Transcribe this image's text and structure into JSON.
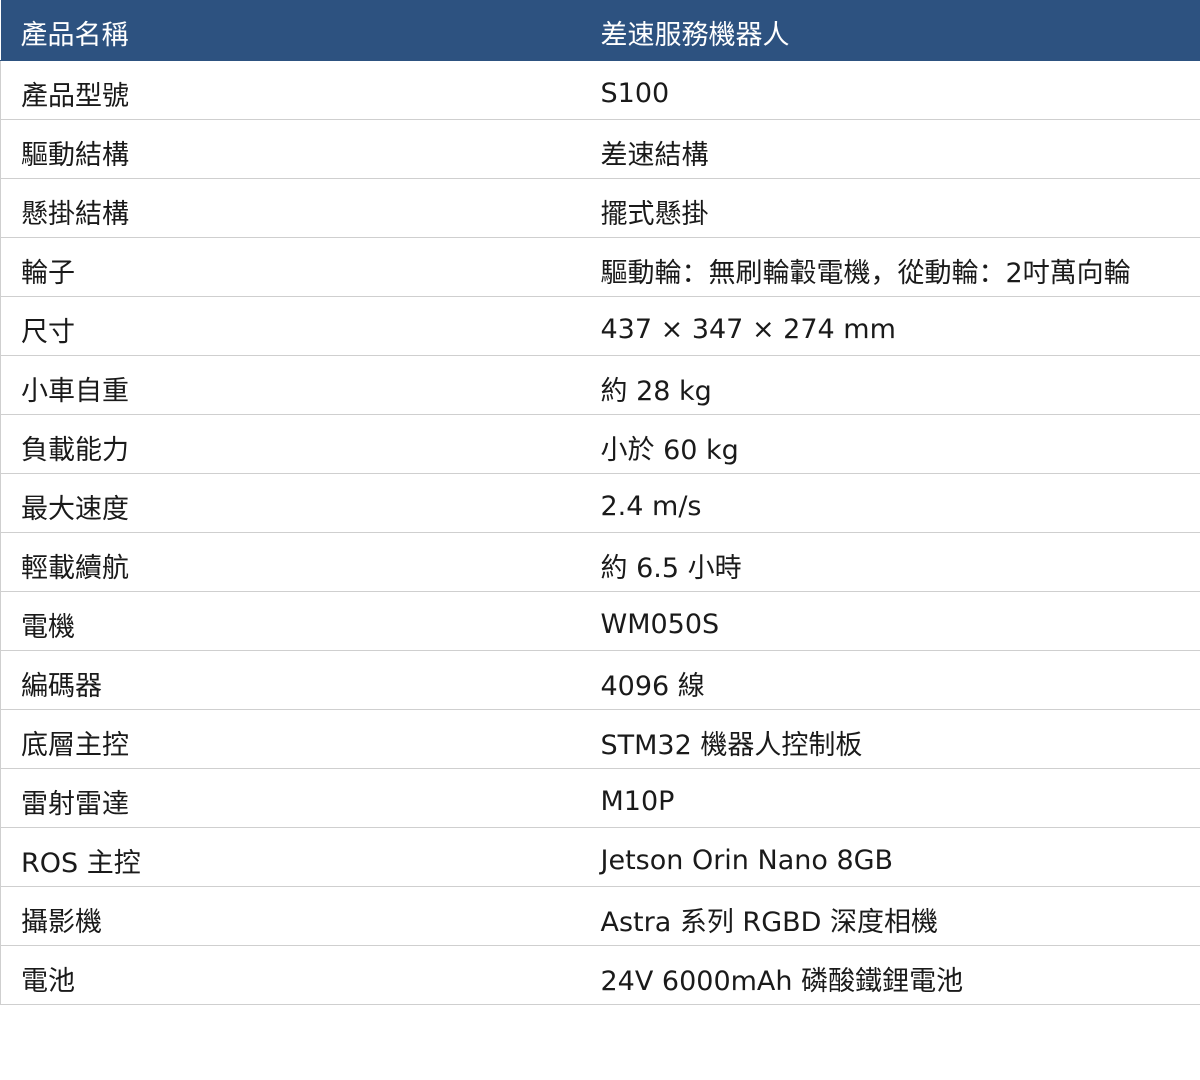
{
  "header": {
    "label": "產品名稱",
    "value": "差速服務機器人"
  },
  "rows": [
    {
      "label": "產品型號",
      "value": "S100"
    },
    {
      "label": "驅動結構",
      "value": "差速結構"
    },
    {
      "label": "懸掛結構",
      "value": "擺式懸掛"
    },
    {
      "label": "輪子",
      "value": "驅動輪：無刷輪轂電機，從動輪：2吋萬向輪"
    },
    {
      "label": "尺寸",
      "value": "437 × 347 × 274 mm"
    },
    {
      "label": "小車自重",
      "value": "約 28 kg"
    },
    {
      "label": "負載能力",
      "value": "小於 60 kg"
    },
    {
      "label": "最大速度",
      "value": "2.4 m/s"
    },
    {
      "label": "輕載續航",
      "value": "約 6.5 小時"
    },
    {
      "label": "電機",
      "value": "WM050S"
    },
    {
      "label": "編碼器",
      "value": "4096 線"
    },
    {
      "label": "底層主控",
      "value": "STM32 機器人控制板"
    },
    {
      "label": "雷射雷達",
      "value": "M10P"
    },
    {
      "label": "ROS 主控",
      "value": "Jetson Orin Nano 8GB"
    },
    {
      "label": "攝影機",
      "value": "Astra 系列 RGBD 深度相機"
    },
    {
      "label": "電池",
      "value": "24V 6000mAh 磷酸鐵鋰電池"
    }
  ],
  "colors": {
    "header_background": "#2d5280",
    "header_text": "#ffffff",
    "row_border": "#cfcfcf"
  }
}
